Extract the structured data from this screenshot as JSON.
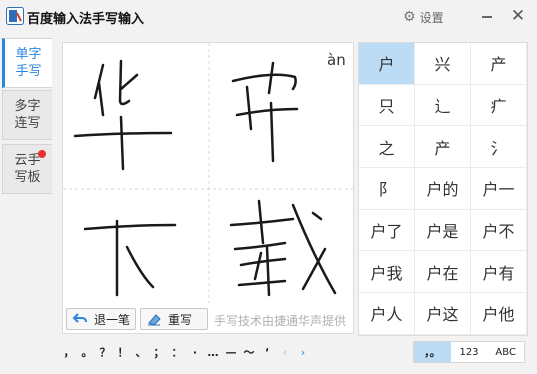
{
  "window": {
    "title": "百度输入法手写输入",
    "settings_label": "设置",
    "close_label": "✕"
  },
  "tabs": [
    {
      "label": "单字手写",
      "active": true
    },
    {
      "label": "多字连写",
      "active": false
    },
    {
      "label": "云手写板",
      "active": false,
      "badge": true
    }
  ],
  "pad": {
    "pinyin": "àn",
    "undo_label": "退一笔",
    "rewrite_label": "重写",
    "credit": "手写技术由捷通华声提供"
  },
  "candidates": [
    "户",
    "兴",
    "产",
    "只",
    "辶",
    "疒",
    "之",
    "产",
    "氵",
    "阝",
    "户的",
    "户一",
    "户了",
    "户是",
    "户不",
    "户我",
    "户在",
    "户有",
    "户人",
    "户这",
    "户他"
  ],
  "selected_candidate": 0,
  "symbols": [
    "，",
    "。",
    "？",
    "！",
    "、",
    "；",
    "：",
    "·",
    "…",
    "—",
    "～",
    "‘"
  ],
  "nav": {
    "prev": "‹",
    "next": "›"
  },
  "modes": [
    {
      "label": "，。",
      "active": true
    },
    {
      "label": "123",
      "active": false
    },
    {
      "label": "ABC",
      "active": false
    }
  ],
  "colors": {
    "accent": "#2a86e0",
    "selected": "#bcdcf5",
    "badge": "#e8312f"
  }
}
